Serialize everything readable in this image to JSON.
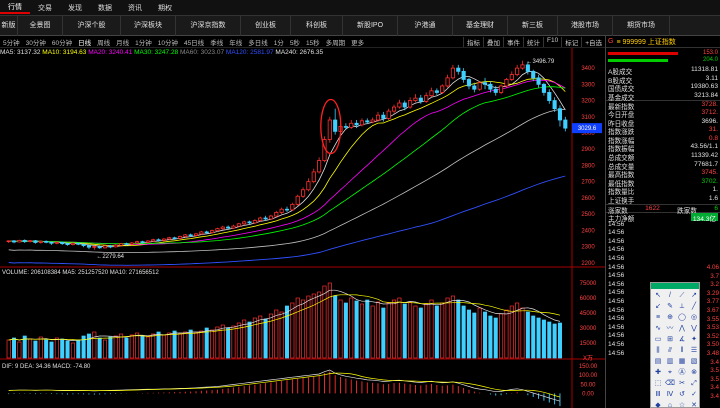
{
  "topbar": {
    "items": [
      "行情",
      "交易",
      "发现",
      "数据",
      "资讯",
      "期权"
    ],
    "active": 0
  },
  "navbar": {
    "tabs": [
      "新版",
      "全景图",
      "沪深个股",
      "沪深板块",
      "沪深京指数",
      "创业板",
      "科创板",
      "新股IPO",
      "沪港通",
      "基金理财",
      "新三板",
      "港股市场",
      "期货市场"
    ]
  },
  "periodbar": {
    "periods": [
      "5分钟",
      "30分钟",
      "60分钟",
      "日线",
      "周线",
      "月线",
      "1分钟",
      "10分钟",
      "45日线",
      "季线",
      "年线",
      "多日线",
      "1分",
      "5秒",
      "15秒",
      "多周期",
      "更多"
    ],
    "active": "日线",
    "tools": [
      "指标",
      "叠加",
      "事件",
      "统计",
      "F10",
      "标记",
      "+自选"
    ]
  },
  "ma_legend": [
    {
      "text": "MA5: 3137.32",
      "color": "#e0e0e0"
    },
    {
      "text": "MA10: 3194.63",
      "color": "#ffff00"
    },
    {
      "text": "MA20: 3240.41",
      "color": "#ff00ff"
    },
    {
      "text": "MA30: 3247.28",
      "color": "#00ff00"
    },
    {
      "text": "MA60: 3023.07",
      "color": "#888888"
    },
    {
      "text": "MA120: 2581.97",
      "color": "#3050ff"
    },
    {
      "text": "MA240: 2676.35",
      "color": "#e0e0e0"
    }
  ],
  "vol_legend": {
    "text": "VOLUME: 206108384 MA5: 251257520 MA10: 271656512"
  },
  "macd_legend": {
    "text": "DIF: 9 DEA: 34.36 MACD: -74.80"
  },
  "price_annotations": {
    "high": "3496.79",
    "low": "2279.64",
    "current": "3029.6"
  },
  "price_axis": [
    "3400",
    "3300",
    "3200",
    "3100",
    "3000",
    "2900",
    "2800",
    "2700",
    "2600",
    "2500",
    "2400",
    "2300",
    "2200"
  ],
  "vol_axis": [
    "75000",
    "60000",
    "45000",
    "30000",
    "15000",
    "X万"
  ],
  "macd_axis": [
    "150.00",
    "100.00",
    "50.00",
    "0.00"
  ],
  "sidebar": {
    "title_g": "G",
    "title": "≡ 999999 上证指数",
    "bar_vals": [
      "153.0",
      "204.0"
    ],
    "stats": [
      {
        "label": "A股成交",
        "value": "11318.81",
        "cls": "white"
      },
      {
        "label": "B股成交",
        "value": "3.11",
        "cls": "white"
      },
      {
        "label": "国债成交",
        "value": "19380.63",
        "cls": "white"
      },
      {
        "label": "基金成交",
        "value": "3213.84",
        "cls": "white"
      },
      {
        "label": "最新指数",
        "value": "3728.",
        "cls": "red"
      },
      {
        "label": "今日开盘",
        "value": "3712.",
        "cls": "red"
      },
      {
        "label": "昨日收盘",
        "value": "3696.",
        "cls": "white"
      },
      {
        "label": "指数涨跌",
        "value": "31.",
        "cls": "red"
      },
      {
        "label": "指数涨幅",
        "value": "0.8",
        "cls": "red"
      },
      {
        "label": "指数振幅",
        "value": "43.56/1.1",
        "cls": "white"
      },
      {
        "label": "总成交额",
        "value": "11339.42",
        "cls": "white"
      },
      {
        "label": "总成交量",
        "value": "77681.7",
        "cls": "white"
      },
      {
        "label": "最高指数",
        "value": "3745.",
        "cls": "red"
      },
      {
        "label": "最低指数",
        "value": "3702.",
        "cls": "green"
      },
      {
        "label": "指数量比",
        "value": "1.",
        "cls": "white"
      },
      {
        "label": "上证换手",
        "value": "1.6",
        "cls": "white"
      }
    ],
    "updown": {
      "up_label": "涨家数",
      "up_value": "1622",
      "down_label": "跌家数",
      "down_value": "6"
    },
    "flow": {
      "label": "主力净额",
      "value": "134.3亿"
    },
    "ticks": [
      "14:56",
      "14:56",
      "14:56",
      "14:56",
      "14:56",
      "14:56",
      "14:56",
      "14:56",
      "14:56",
      "14:56",
      "14:56",
      "14:56",
      "14:56",
      "14:56",
      "14:56",
      "14:56"
    ],
    "tick_vals": [
      "4.06",
      "3.7",
      "3.2",
      "3.29",
      "3.77",
      "3.67",
      "3.55",
      "3.53",
      "3.52",
      "3.50",
      "3.48",
      "3.4",
      "3.5",
      "3.5",
      "3.4",
      "3.4"
    ]
  },
  "draw_tools": [
    "↖",
    "/",
    "⟋",
    "↗",
    "↙",
    "✎",
    "⟂",
    "╱",
    "≡",
    "⊕",
    "◯",
    "◎",
    "∿",
    "〰",
    "⋀",
    "⋁",
    "▭",
    "⊞",
    "∡",
    "✦",
    "⫼",
    "⫻",
    "‖",
    "☰",
    "▤",
    "▥",
    "▦",
    "▧",
    "✚",
    "⌖",
    "Ⓐ",
    "⊗",
    "⬚",
    "⌫",
    "✂",
    "⤢",
    "Ⅲ",
    "Ⅳ",
    "↺",
    "✓",
    "◆",
    "⌂",
    "☆",
    "✕"
  ],
  "chart_data": {
    "type": "candlestick",
    "y_range": [
      2180,
      3450
    ],
    "candles": [
      [
        2330,
        2335,
        2322,
        2338
      ],
      [
        2335,
        2328,
        2320,
        2340
      ],
      [
        2328,
        2338,
        2325,
        2342
      ],
      [
        2338,
        2330,
        2322,
        2344
      ],
      [
        2330,
        2336,
        2326,
        2340
      ],
      [
        2336,
        2325,
        2318,
        2340
      ],
      [
        2325,
        2332,
        2318,
        2336
      ],
      [
        2332,
        2326,
        2320,
        2338
      ],
      [
        2326,
        2320,
        2310,
        2330
      ],
      [
        2320,
        2326,
        2314,
        2330
      ],
      [
        2326,
        2318,
        2310,
        2330
      ],
      [
        2318,
        2312,
        2305,
        2322
      ],
      [
        2312,
        2320,
        2306,
        2326
      ],
      [
        2320,
        2314,
        2308,
        2324
      ],
      [
        2314,
        2306,
        2296,
        2318
      ],
      [
        2306,
        2296,
        2284,
        2310
      ],
      [
        2296,
        2300,
        2280,
        2306
      ],
      [
        2300,
        2292,
        2286,
        2306
      ],
      [
        2292,
        2304,
        2288,
        2310
      ],
      [
        2304,
        2298,
        2290,
        2310
      ],
      [
        2298,
        2308,
        2294,
        2314
      ],
      [
        2308,
        2318,
        2300,
        2322
      ],
      [
        2318,
        2314,
        2306,
        2324
      ],
      [
        2314,
        2322,
        2308,
        2328
      ],
      [
        2322,
        2330,
        2316,
        2336
      ],
      [
        2330,
        2326,
        2318,
        2336
      ],
      [
        2326,
        2334,
        2320,
        2340
      ],
      [
        2334,
        2342,
        2328,
        2348
      ],
      [
        2342,
        2338,
        2330,
        2350
      ],
      [
        2338,
        2346,
        2332,
        2352
      ],
      [
        2346,
        2354,
        2340,
        2360
      ],
      [
        2354,
        2350,
        2342,
        2360
      ],
      [
        2350,
        2362,
        2346,
        2368
      ],
      [
        2362,
        2372,
        2356,
        2378
      ],
      [
        2372,
        2368,
        2360,
        2380
      ],
      [
        2368,
        2378,
        2362,
        2384
      ],
      [
        2378,
        2390,
        2372,
        2396
      ],
      [
        2390,
        2386,
        2378,
        2398
      ],
      [
        2386,
        2398,
        2380,
        2404
      ],
      [
        2398,
        2410,
        2392,
        2416
      ],
      [
        2410,
        2420,
        2402,
        2428
      ],
      [
        2420,
        2414,
        2406,
        2430
      ],
      [
        2414,
        2426,
        2408,
        2434
      ],
      [
        2426,
        2440,
        2420,
        2446
      ],
      [
        2440,
        2452,
        2432,
        2460
      ],
      [
        2452,
        2446,
        2438,
        2460
      ],
      [
        2446,
        2460,
        2440,
        2468
      ],
      [
        2460,
        2476,
        2454,
        2484
      ],
      [
        2476,
        2470,
        2460,
        2490
      ],
      [
        2470,
        2488,
        2464,
        2496
      ],
      [
        2488,
        2510,
        2480,
        2520
      ],
      [
        2510,
        2530,
        2500,
        2540
      ],
      [
        2530,
        2526,
        2512,
        2546
      ],
      [
        2526,
        2560,
        2520,
        2570
      ],
      [
        2560,
        2610,
        2552,
        2620
      ],
      [
        2610,
        2650,
        2600,
        2665
      ],
      [
        2650,
        2700,
        2640,
        2720
      ],
      [
        2700,
        2760,
        2690,
        2780
      ],
      [
        2760,
        2830,
        2750,
        2850
      ],
      [
        2830,
        2960,
        2820,
        2980
      ],
      [
        2960,
        3080,
        2940,
        3100
      ],
      [
        3080,
        3010,
        2990,
        3150
      ],
      [
        3010,
        3040,
        2995,
        3060
      ],
      [
        3040,
        3035,
        3020,
        3060
      ],
      [
        3035,
        3060,
        3025,
        3080
      ],
      [
        3060,
        3050,
        3030,
        3080
      ],
      [
        3050,
        3075,
        3040,
        3090
      ],
      [
        3075,
        3068,
        3055,
        3090
      ],
      [
        3068,
        3080,
        3060,
        3095
      ],
      [
        3080,
        3110,
        3070,
        3130
      ],
      [
        3110,
        3090,
        3070,
        3130
      ],
      [
        3090,
        3135,
        3080,
        3150
      ],
      [
        3135,
        3160,
        3120,
        3175
      ],
      [
        3160,
        3185,
        3150,
        3205
      ],
      [
        3185,
        3160,
        3140,
        3200
      ],
      [
        3160,
        3200,
        3150,
        3220
      ],
      [
        3200,
        3215,
        3190,
        3240
      ],
      [
        3215,
        3195,
        3180,
        3235
      ],
      [
        3195,
        3230,
        3185,
        3250
      ],
      [
        3230,
        3260,
        3220,
        3280
      ],
      [
        3260,
        3250,
        3235,
        3275
      ],
      [
        3250,
        3290,
        3240,
        3300
      ],
      [
        3290,
        3340,
        3280,
        3360
      ],
      [
        3340,
        3400,
        3330,
        3420
      ],
      [
        3400,
        3380,
        3360,
        3420
      ],
      [
        3380,
        3330,
        3310,
        3400
      ],
      [
        3330,
        3290,
        3270,
        3340
      ],
      [
        3290,
        3270,
        3250,
        3310
      ],
      [
        3270,
        3310,
        3260,
        3320
      ],
      [
        3310,
        3300,
        3270,
        3340
      ],
      [
        3300,
        3270,
        3250,
        3320
      ],
      [
        3270,
        3250,
        3230,
        3290
      ],
      [
        3250,
        3290,
        3240,
        3300
      ],
      [
        3290,
        3330,
        3280,
        3340
      ],
      [
        3330,
        3360,
        3320,
        3380
      ],
      [
        3360,
        3400,
        3350,
        3420
      ],
      [
        3400,
        3420,
        3390,
        3445
      ],
      [
        3420,
        3380,
        3360,
        3440
      ],
      [
        3380,
        3340,
        3320,
        3390
      ],
      [
        3340,
        3300,
        3280,
        3360
      ],
      [
        3300,
        3250,
        3230,
        3310
      ],
      [
        3250,
        3200,
        3180,
        3270
      ],
      [
        3200,
        3150,
        3130,
        3220
      ],
      [
        3150,
        3080,
        3040,
        3170
      ],
      [
        3080,
        3030,
        3010,
        3100
      ]
    ],
    "volumes": [
      18,
      20,
      16,
      22,
      19,
      17,
      21,
      18,
      16,
      20,
      19,
      17,
      15,
      18,
      22,
      24,
      26,
      20,
      18,
      21,
      22,
      24,
      20,
      23,
      25,
      22,
      21,
      24,
      26,
      23,
      25,
      27,
      24,
      26,
      28,
      25,
      27,
      30,
      28,
      31,
      33,
      30,
      32,
      35,
      38,
      36,
      40,
      42,
      39,
      44,
      48,
      46,
      52,
      55,
      60,
      58,
      62,
      64,
      66,
      72,
      75,
      62,
      58,
      55,
      60,
      57,
      54,
      58,
      52,
      56,
      50,
      55,
      58,
      60,
      54,
      56,
      52,
      50,
      54,
      58,
      52,
      55,
      60,
      62,
      58,
      52,
      48,
      45,
      50,
      46,
      42,
      40,
      44,
      48,
      52,
      55,
      50,
      46,
      42,
      40,
      38,
      36,
      34,
      35
    ],
    "macd": [
      -4,
      -3,
      -2,
      -2,
      -3,
      -4,
      -3,
      -2,
      -3,
      -4,
      -5,
      -6,
      -5,
      -4,
      -5,
      -6,
      -7,
      -6,
      -5,
      -4,
      -3,
      -2,
      -1,
      0,
      1,
      2,
      3,
      3,
      4,
      5,
      6,
      7,
      8,
      9,
      10,
      12,
      14,
      16,
      18,
      20,
      24,
      28,
      32,
      36,
      40,
      44,
      48,
      52,
      56,
      60,
      64,
      68,
      72,
      76,
      80,
      84,
      88,
      92,
      96,
      110,
      120,
      100,
      90,
      82,
      76,
      70,
      66,
      60,
      58,
      55,
      50,
      52,
      56,
      58,
      54,
      50,
      46,
      44,
      48,
      52,
      46,
      42,
      44,
      48,
      40,
      30,
      20,
      10,
      4,
      0,
      -6,
      -12,
      -10,
      -4,
      2,
      6,
      0,
      -10,
      -20,
      -30,
      -40,
      -50,
      -60,
      -70
    ]
  }
}
